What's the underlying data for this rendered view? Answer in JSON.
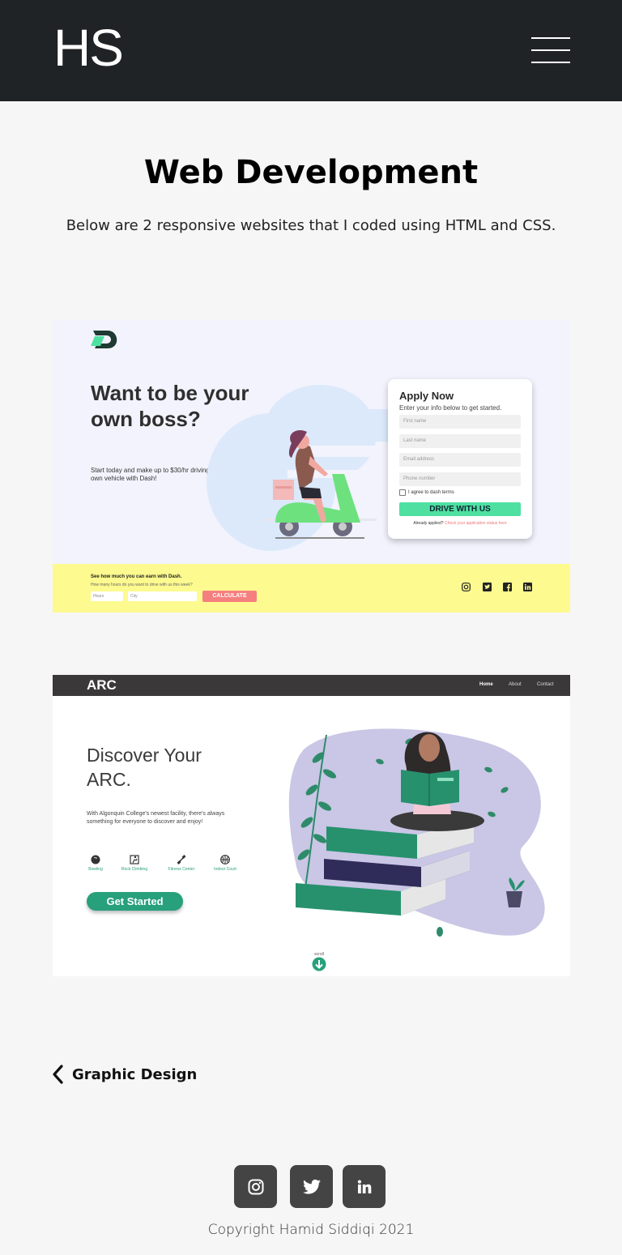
{
  "header": {
    "logo": "HS"
  },
  "main": {
    "title": "Web Development",
    "intro": "Below are 2 responsive websites that I coded using HTML and CSS."
  },
  "projects": {
    "dash": {
      "headline": "Want to be your own boss?",
      "subtext": "Start today and make up to $30/hr driving your own vehicle with Dash!",
      "form": {
        "title": "Apply Now",
        "subtitle": "Enter your info below to get started.",
        "fields": [
          "First name",
          "Last name",
          "Email address",
          "Phone number"
        ],
        "agree": "I agree to dash terms",
        "button": "DRIVE WITH US",
        "footer": "Already applied?",
        "footer_link": "Check your application status here"
      },
      "calc": {
        "title": "See how much you can earn with Dash.",
        "subtitle": "How many hours do you want to drive with us this week?",
        "hours_placeholder": "Hours",
        "city_placeholder": "City",
        "button": "CALCULATE"
      },
      "social_icons": [
        "instagram-icon",
        "twitter-icon",
        "facebook-icon",
        "linkedin-icon"
      ]
    },
    "arc": {
      "logo": "ARC",
      "nav": [
        "Home",
        "About",
        "Contact"
      ],
      "headline": "Discover Your ARC.",
      "subtext": "With Algonquin College's newest facility, there's always something for everyone to discover and enjoy!",
      "features": [
        "Bowling",
        "Rock Climbing",
        "Fitness Center",
        "Indoor Court"
      ],
      "button": "Get Started",
      "scroll": "scroll"
    }
  },
  "nav_links": {
    "back": "Graphic Design"
  },
  "footer": {
    "social": [
      "instagram-icon",
      "twitter-icon",
      "linkedin-icon"
    ],
    "copyright": "Copyright Hamid Siddiqi  2021"
  },
  "colors": {
    "header_bg": "#202326",
    "page_bg": "#f6f6f6",
    "dash_accent": "#4fe0a1",
    "dash_calc_bg": "#fdfa8f",
    "dash_calc_btn": "#f57f7f",
    "arc_accent": "#27a07b",
    "footer_btn": "#444444"
  }
}
